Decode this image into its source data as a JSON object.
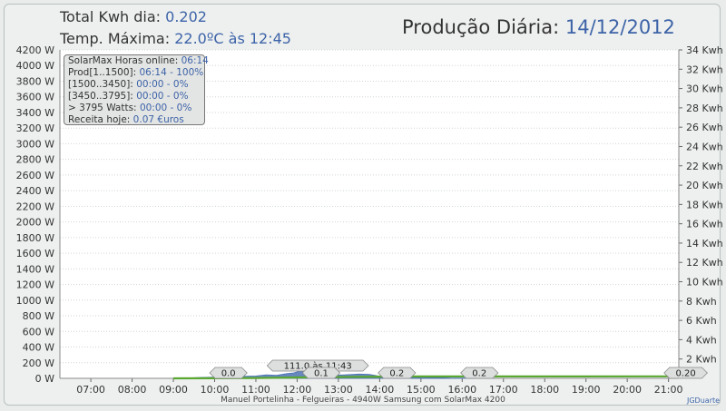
{
  "header": {
    "kwh_label": "Total Kwh dia:",
    "kwh_value": "0.202",
    "temp_label": "Temp. Máxima:",
    "temp_value": "22.0ºC às 12:45",
    "title_label": "Produção Diária:",
    "title_date": "14/12/2012"
  },
  "stats_box": {
    "rows": [
      {
        "label": "SolarMax Horas online:",
        "value": "06:14"
      },
      {
        "label": "Prod[1..1500]:",
        "value": "06:14 - 100%"
      },
      {
        "label": "[1500..3450]:",
        "value": "00:00 - 0%"
      },
      {
        "label": "[3450..3795]:",
        "value": "00:00 - 0%"
      },
      {
        "label": "> 3795 Watts:",
        "value": "00:00 - 0%"
      },
      {
        "label": "Receita hoje:",
        "value": "0.07 €uros"
      }
    ]
  },
  "footer_text": "Manuel Portelinha - Felgueiras -  4940W Samsung com SolarMax 4200",
  "credit_text": "JGDuarte",
  "colors": {
    "power_fill": "#4b73b3",
    "energy_line": "#5aa832",
    "text_value": "#3d63a8",
    "grid": "#cfd6d3"
  },
  "chart_data": {
    "type": "area",
    "title": "Produção Diária: 14/12/2012",
    "x_ticks": [
      "07:00",
      "08:00",
      "09:00",
      "10:00",
      "11:00",
      "12:00",
      "13:00",
      "14:00",
      "15:00",
      "16:00",
      "17:00",
      "18:00",
      "19:00",
      "20:00",
      "21:00"
    ],
    "xlim": [
      "06:15",
      "21:15"
    ],
    "y_left": {
      "unit": "W",
      "ylim": [
        0,
        4200
      ],
      "ticks": [
        "0 W",
        "200 W",
        "400 W",
        "600 W",
        "800 W",
        "1000 W",
        "1200 W",
        "1400 W",
        "1600 W",
        "1800 W",
        "2000 W",
        "2200 W",
        "2400 W",
        "2600 W",
        "2800 W",
        "3000 W",
        "3200 W",
        "3400 W",
        "3600 W",
        "3800 W",
        "4000 W",
        "4200 W"
      ]
    },
    "y_right": {
      "unit": "Kwh",
      "ylim": [
        0,
        34
      ],
      "ticks": [
        "2 Kwh",
        "4 Kwh",
        "6 Kwh",
        "8 Kwh",
        "10 Kwh",
        "12 Kwh",
        "14 Kwh",
        "16 Kwh",
        "18 Kwh",
        "20 Kwh",
        "22 Kwh",
        "24 Kwh",
        "26 Kwh",
        "28 Kwh",
        "30 Kwh",
        "32 Kwh",
        "34 Kwh"
      ]
    },
    "grid": true,
    "series": [
      {
        "kind": "power",
        "points": [
          [
            "09:00",
            0
          ],
          [
            "09:20",
            5
          ],
          [
            "09:40",
            12
          ],
          [
            "10:00",
            15
          ],
          [
            "10:20",
            20
          ],
          [
            "10:40",
            25
          ],
          [
            "11:00",
            30
          ],
          [
            "11:15",
            45
          ],
          [
            "11:30",
            38
          ],
          [
            "11:45",
            60
          ],
          [
            "11:55",
            70
          ],
          [
            "12:05",
            95
          ],
          [
            "12:15",
            60
          ],
          [
            "12:30",
            50
          ],
          [
            "12:45",
            40
          ],
          [
            "13:00",
            42
          ],
          [
            "13:15",
            48
          ],
          [
            "13:30",
            55
          ],
          [
            "13:45",
            50
          ],
          [
            "14:00",
            28
          ],
          [
            "14:15",
            22
          ],
          [
            "14:30",
            20
          ],
          [
            "14:45",
            15
          ],
          [
            "15:00",
            12
          ],
          [
            "15:15",
            10
          ],
          [
            "15:30",
            8
          ],
          [
            "15:45",
            5
          ],
          [
            "16:00",
            3
          ],
          [
            "16:20",
            0
          ]
        ]
      },
      {
        "kind": "energy",
        "points": [
          [
            "09:00",
            0
          ],
          [
            "10:00",
            0.01
          ],
          [
            "11:00",
            0.04
          ],
          [
            "12:00",
            0.09
          ],
          [
            "13:00",
            0.14
          ],
          [
            "14:00",
            0.18
          ],
          [
            "15:00",
            0.195
          ],
          [
            "16:00",
            0.2
          ],
          [
            "21:00",
            0.202
          ]
        ]
      }
    ],
    "annotations": [
      {
        "text": "0.0",
        "x": "10:20"
      },
      {
        "text": "111.0 às 11:43",
        "x": "12:30"
      },
      {
        "text": "0.1",
        "x": "12:35"
      },
      {
        "text": "0.2",
        "x": "14:25"
      },
      {
        "text": "0.2",
        "x": "16:25"
      },
      {
        "text": "0.20",
        "x": "21:25"
      }
    ]
  }
}
